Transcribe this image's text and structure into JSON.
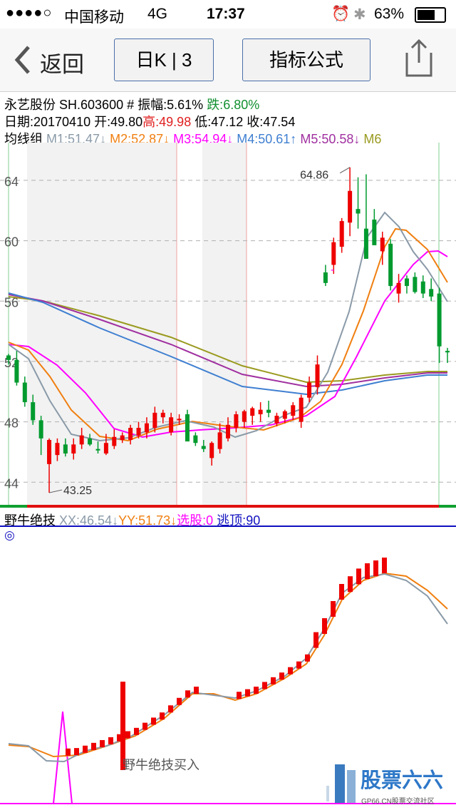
{
  "status_bar": {
    "carrier": "中国移动",
    "network": "4G",
    "time": "17:37",
    "battery": "63%"
  },
  "nav": {
    "back_label": "返回",
    "period_label": "日K | 3",
    "formula_label": "指标公式"
  },
  "stock": {
    "name": "永艺股份",
    "code": "SH.603600",
    "amplitude": "# 振幅:5.61%",
    "change": "跌:6.80%",
    "date": "日期:20170410",
    "open": "开:49.80",
    "high": "高:49.98",
    "low": "低:47.12",
    "close": "收:47.54"
  },
  "ma_group": {
    "label": "均线组",
    "items": [
      {
        "text": "M1:51.47↓",
        "color": "#8a9aa8"
      },
      {
        "text": "M2:52.87↓",
        "color": "#f07f10"
      },
      {
        "text": "M3:54.94↓",
        "color": "#ff00ff"
      },
      {
        "text": "M4:50.61↑",
        "color": "#3f7fd1"
      },
      {
        "text": "M5:50.58↓",
        "color": "#a030a0"
      },
      {
        "text": "M6",
        "color": "#9a9a20"
      }
    ]
  },
  "indicator": {
    "label": "野牛绝技",
    "xx": "XX:46.54↓",
    "yy": "YY:51.73↓",
    "select": "选股:0",
    "escape": "逃顶:90",
    "marker": "◎",
    "signal_text": "野牛绝技买入"
  },
  "watermark": {
    "text": "股票六六",
    "sub": "GP66.CN股票交流社区"
  },
  "chart_data": {
    "type": "candlestick",
    "ylim": [
      42.5,
      66.5
    ],
    "y_ticks": [
      64,
      60,
      56,
      52,
      48,
      44
    ],
    "annotations": [
      {
        "text": "64.86"
      },
      {
        "text": "43.25"
      }
    ],
    "colors": {
      "up": "#ee0000",
      "down": "#009a2e"
    },
    "candles": [
      [
        52.4,
        52.5,
        51.8,
        52.1
      ],
      [
        52.1,
        52.7,
        50.4,
        50.6
      ],
      [
        50.6,
        51.0,
        49.0,
        49.3
      ],
      [
        49.3,
        49.8,
        47.8,
        48.1
      ],
      [
        48.1,
        48.4,
        45.8,
        46.9
      ],
      [
        45.2,
        46.9,
        43.3,
        46.8
      ],
      [
        45.8,
        46.9,
        45.4,
        46.6
      ],
      [
        46.5,
        46.9,
        45.7,
        45.9
      ],
      [
        45.9,
        46.9,
        45.5,
        46.5
      ],
      [
        46.5,
        47.6,
        46.2,
        47.1
      ],
      [
        46.9,
        47.2,
        46.4,
        46.5
      ],
      [
        46.2,
        46.7,
        45.9,
        46.1
      ],
      [
        45.9,
        47.2,
        45.8,
        46.6
      ],
      [
        46.4,
        47.5,
        46.2,
        47.0
      ],
      [
        46.8,
        47.3,
        46.6,
        47.1
      ],
      [
        46.8,
        47.8,
        46.5,
        47.6
      ],
      [
        47.1,
        48.0,
        46.9,
        47.6
      ],
      [
        47.3,
        48.3,
        46.9,
        47.9
      ],
      [
        47.6,
        49.0,
        47.3,
        48.6
      ],
      [
        48.3,
        48.8,
        47.9,
        48.6
      ],
      [
        47.3,
        48.6,
        47.1,
        48.3
      ],
      [
        48.1,
        48.5,
        47.8,
        48.2
      ],
      [
        48.5,
        48.8,
        46.9,
        46.7
      ],
      [
        47.1,
        47.3,
        46.4,
        46.6
      ],
      [
        46.4,
        46.8,
        46.0,
        46.2
      ],
      [
        45.6,
        46.7,
        45.1,
        46.6
      ],
      [
        46.2,
        47.9,
        45.9,
        47.3
      ],
      [
        46.9,
        48.3,
        46.7,
        47.8
      ],
      [
        47.6,
        48.7,
        47.3,
        48.5
      ],
      [
        48.0,
        48.8,
        47.6,
        48.7
      ],
      [
        48.4,
        49.0,
        47.8,
        48.9
      ],
      [
        48.5,
        49.3,
        48.0,
        48.8
      ],
      [
        48.8,
        49.4,
        48.3,
        48.6
      ],
      [
        47.9,
        48.6,
        47.7,
        48.4
      ],
      [
        48.2,
        48.8,
        47.9,
        48.7
      ],
      [
        48.4,
        49.3,
        48.1,
        49.1
      ],
      [
        48.0,
        49.8,
        47.6,
        49.6
      ],
      [
        49.6,
        51.0,
        49.3,
        50.6
      ],
      [
        50.3,
        52.4,
        49.8,
        51.8
      ],
      [
        57.9,
        58.4,
        57.0,
        57.2
      ],
      [
        58.4,
        60.2,
        57.8,
        59.9
      ],
      [
        59.6,
        61.5,
        59.2,
        61.3
      ],
      [
        61.2,
        64.86,
        60.3,
        63.3
      ],
      [
        62.1,
        64.2,
        60.8,
        61.8
      ],
      [
        60.8,
        64.4,
        58.9,
        58.8
      ],
      [
        61.4,
        62.1,
        59.8,
        59.7
      ],
      [
        59.3,
        60.6,
        58.4,
        60.2
      ],
      [
        59.8,
        60.1,
        56.7,
        57.0
      ],
      [
        56.5,
        57.8,
        55.9,
        57.2
      ],
      [
        57.5,
        57.7,
        56.5,
        57.0
      ],
      [
        57.6,
        57.9,
        56.5,
        56.6
      ],
      [
        57.3,
        57.7,
        56.2,
        56.5
      ],
      [
        56.8,
        57.5,
        56.0,
        56.3
      ],
      [
        56.5,
        56.9,
        51.9,
        53.0
      ],
      [
        52.7,
        52.9,
        51.9,
        52.6
      ]
    ]
  }
}
